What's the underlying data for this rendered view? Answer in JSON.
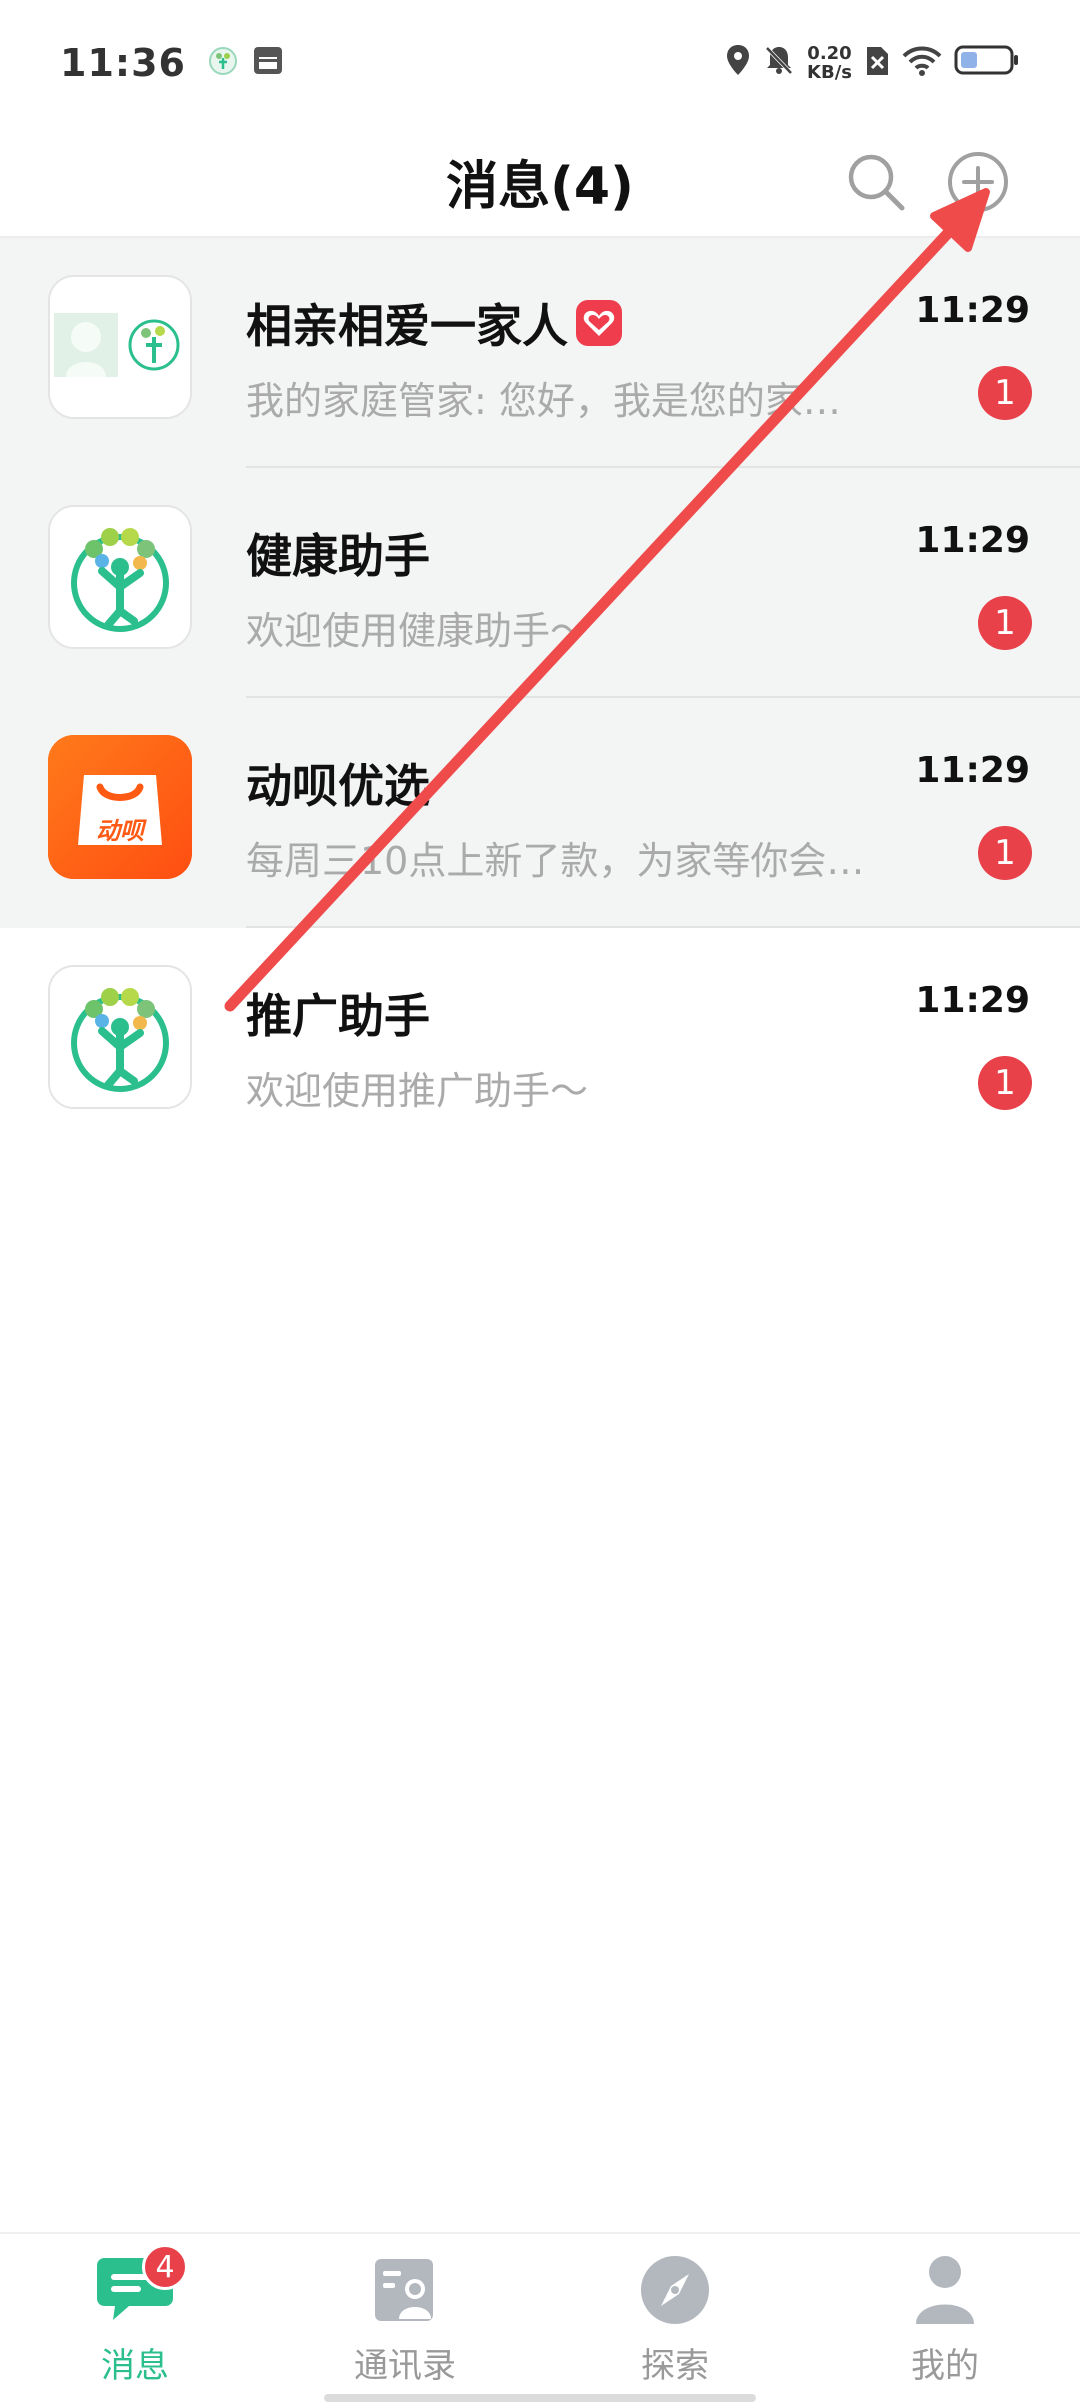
{
  "status_bar": {
    "time": "11:36",
    "net_speed_value": "0.20",
    "net_speed_unit": "KB/s"
  },
  "header": {
    "title": "消息(4)"
  },
  "conversations": [
    {
      "name": "相亲相爱一家人",
      "preview": "我的家庭管家: 您好，我是您的家…",
      "time": "11:29",
      "unread": "1"
    },
    {
      "name": "健康助手",
      "preview": "欢迎使用健康助手～",
      "time": "11:29",
      "unread": "1"
    },
    {
      "name": "动呗优选",
      "preview": "每周三10点上新了款，为家等你会…",
      "time": "11:29",
      "unread": "1",
      "logo_text": "动呗"
    },
    {
      "name": "推广助手",
      "preview": "欢迎使用推广助手～",
      "time": "11:29",
      "unread": "1"
    }
  ],
  "bottom_nav": [
    {
      "label": "消息",
      "icon": "chat-bubble-icon",
      "badge": "4",
      "active": true
    },
    {
      "label": "通讯录",
      "icon": "contacts-icon"
    },
    {
      "label": "探索",
      "icon": "compass-icon"
    },
    {
      "label": "我的",
      "icon": "profile-icon"
    }
  ],
  "colors": {
    "accent": "#2bbf8e",
    "badge": "#e8414a",
    "annotation_arrow": "#ef4b4b",
    "list_highlight": "#f3f4f4"
  }
}
